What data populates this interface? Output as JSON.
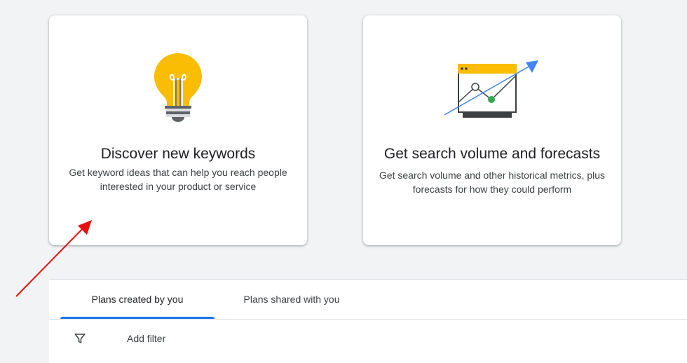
{
  "cards": [
    {
      "title": "Discover new keywords",
      "description": "Get keyword ideas that can help you reach people interested in your product or service",
      "icon": "lightbulb-icon"
    },
    {
      "title": "Get search volume and forecasts",
      "description": "Get search volume and other historical metrics, plus forecasts for how they could perform",
      "icon": "trend-chart-icon"
    }
  ],
  "plans": {
    "tabs": [
      {
        "label": "Plans created by you",
        "active": true
      },
      {
        "label": "Plans shared with you",
        "active": false
      }
    ],
    "filter": {
      "label": "Add filter",
      "icon": "filter-icon"
    }
  },
  "colors": {
    "page_background": "#f1f3f4",
    "accent_blue": "#1a73e8",
    "bulb_yellow": "#fbbc04",
    "chart_green": "#34a853",
    "annotation_red": "#e8110f"
  }
}
